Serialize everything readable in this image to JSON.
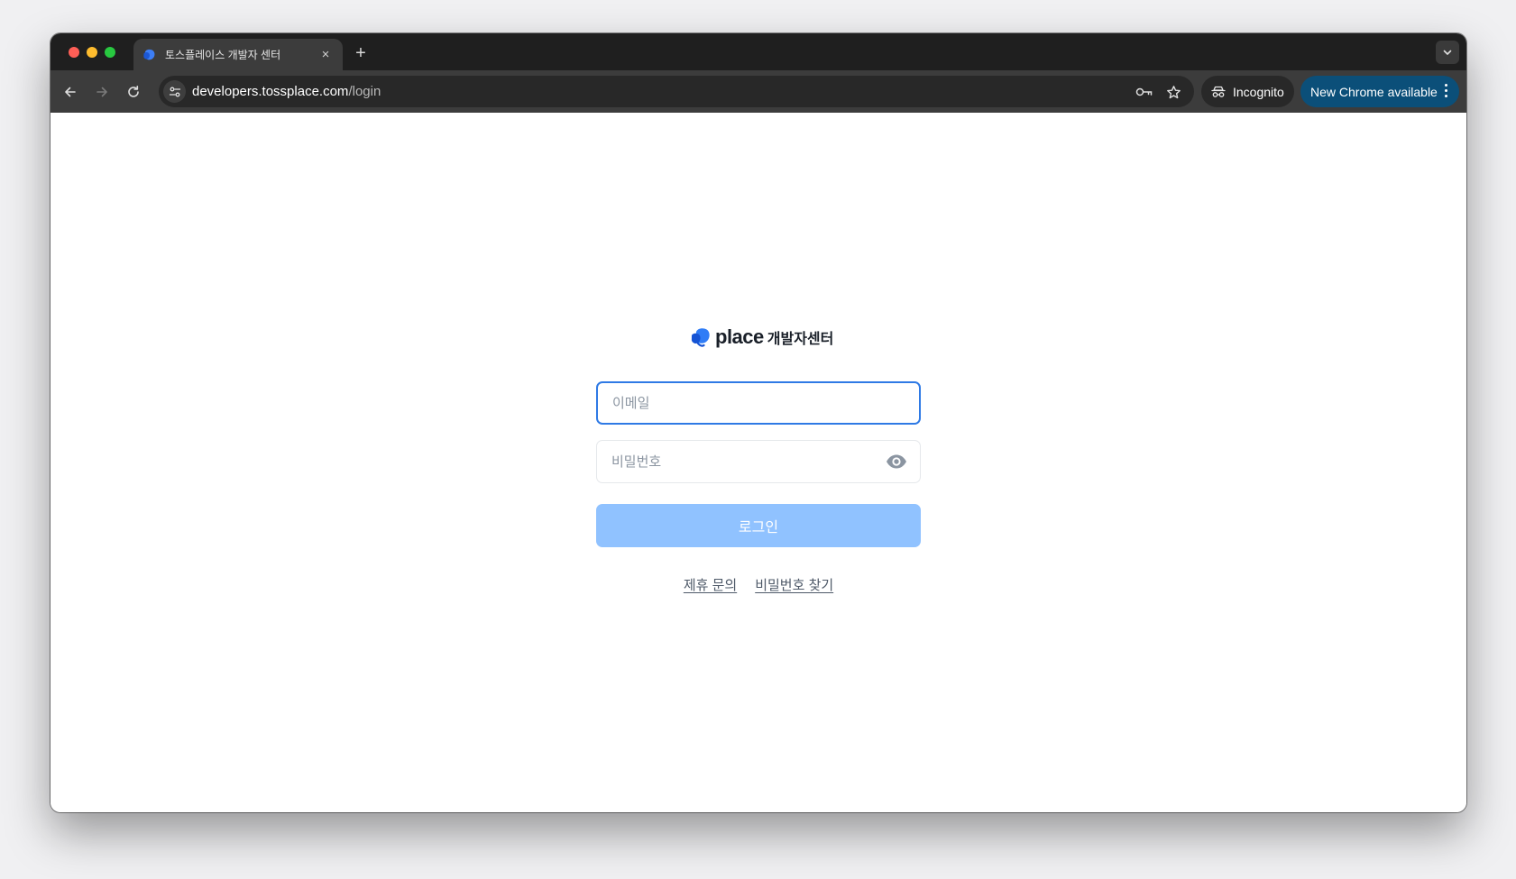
{
  "browser": {
    "tab": {
      "title": "토스플레이스 개발자 센터",
      "favicon": "place-logo-icon",
      "close_glyph": "×"
    },
    "new_tab_glyph": "+",
    "address_bar": {
      "url_host": "developers.tossplace.com",
      "url_path": "/login"
    },
    "incognito_label": "Incognito",
    "update_label": "New Chrome available",
    "colors": {
      "tabstrip": "#1f1f1f",
      "toolbar": "#3c3c3c",
      "update_chip": "#0b4f79"
    }
  },
  "page": {
    "logo": {
      "wordmark": "place",
      "subtitle": "개발자센터",
      "mark_color": "#1c6bf0"
    },
    "email_field": {
      "placeholder": "이메일",
      "value": ""
    },
    "password_field": {
      "placeholder": "비밀번호",
      "value": "",
      "toggle_icon": "eye-icon"
    },
    "login_button_label": "로그인",
    "links": {
      "partnership": "제휴 문의",
      "find_password": "비밀번호 찾기"
    },
    "colors": {
      "accent": "#2f7ae5",
      "login_button": "#90c2ff"
    }
  }
}
